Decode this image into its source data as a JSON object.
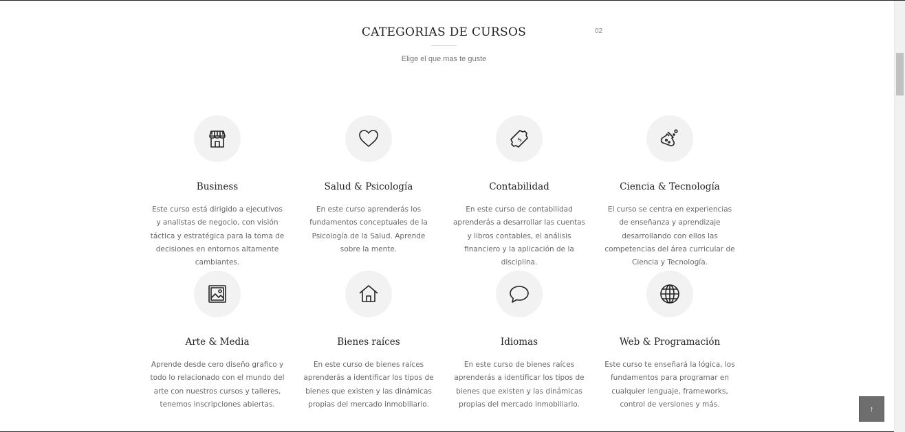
{
  "header": {
    "title": "CATEGORIAS DE CURSOS",
    "section_number": "02",
    "subtitle": "Elige el que mas te guste"
  },
  "categories": [
    {
      "title": "Business",
      "icon": "store-icon",
      "description": "Este curso está dirigido a ejecutivos y analistas de negocio, con visión táctica y estratégica para la toma de decisiones en entornos altamente cambiantes."
    },
    {
      "title": "Salud & Psicología",
      "icon": "heart-icon",
      "description": "En este curso aprenderás los fundamentos conceptuales de la Psicología de la Salud. Aprende sobre la mente."
    },
    {
      "title": "Contabilidad",
      "icon": "money-icon",
      "description": "En este curso de contabilidad aprenderás a desarrollar las cuentas y libros contables, el análisis financiero y la aplicación de la disciplina."
    },
    {
      "title": "Ciencia & Tecnología",
      "icon": "flask-icon",
      "description": "El curso se centra en experiencias de enseñanza y aprendizaje desarrollando con ellos las competencias del área curricular de Ciencia y Tecnología."
    },
    {
      "title": "Arte & Media",
      "icon": "picture-icon",
      "description": "Aprende desde cero diseño grafico y todo lo relacionado con el mundo del arte con nuestros cursos y talleres, tenemos inscripciones abiertas."
    },
    {
      "title": "Bienes raíces",
      "icon": "house-icon",
      "description": "En este curso de bienes raíces aprenderás a identificar los tipos de bienes que existen y las dinámicas propias del mercado inmobiliario."
    },
    {
      "title": "Idiomas",
      "icon": "speech-bubble-icon",
      "description": "En este curso de bienes raíces aprenderás a identificar los tipos de bienes que existen y las dinámicas propias del mercado inmobiliario."
    },
    {
      "title": "Web & Programación",
      "icon": "globe-icon",
      "description": "Este curso te enseñará la lógica, los fundamentos para programar en cualquier lenguaje, frameworks, control de versiones y más."
    }
  ],
  "back_to_top": {
    "label": "↑"
  }
}
